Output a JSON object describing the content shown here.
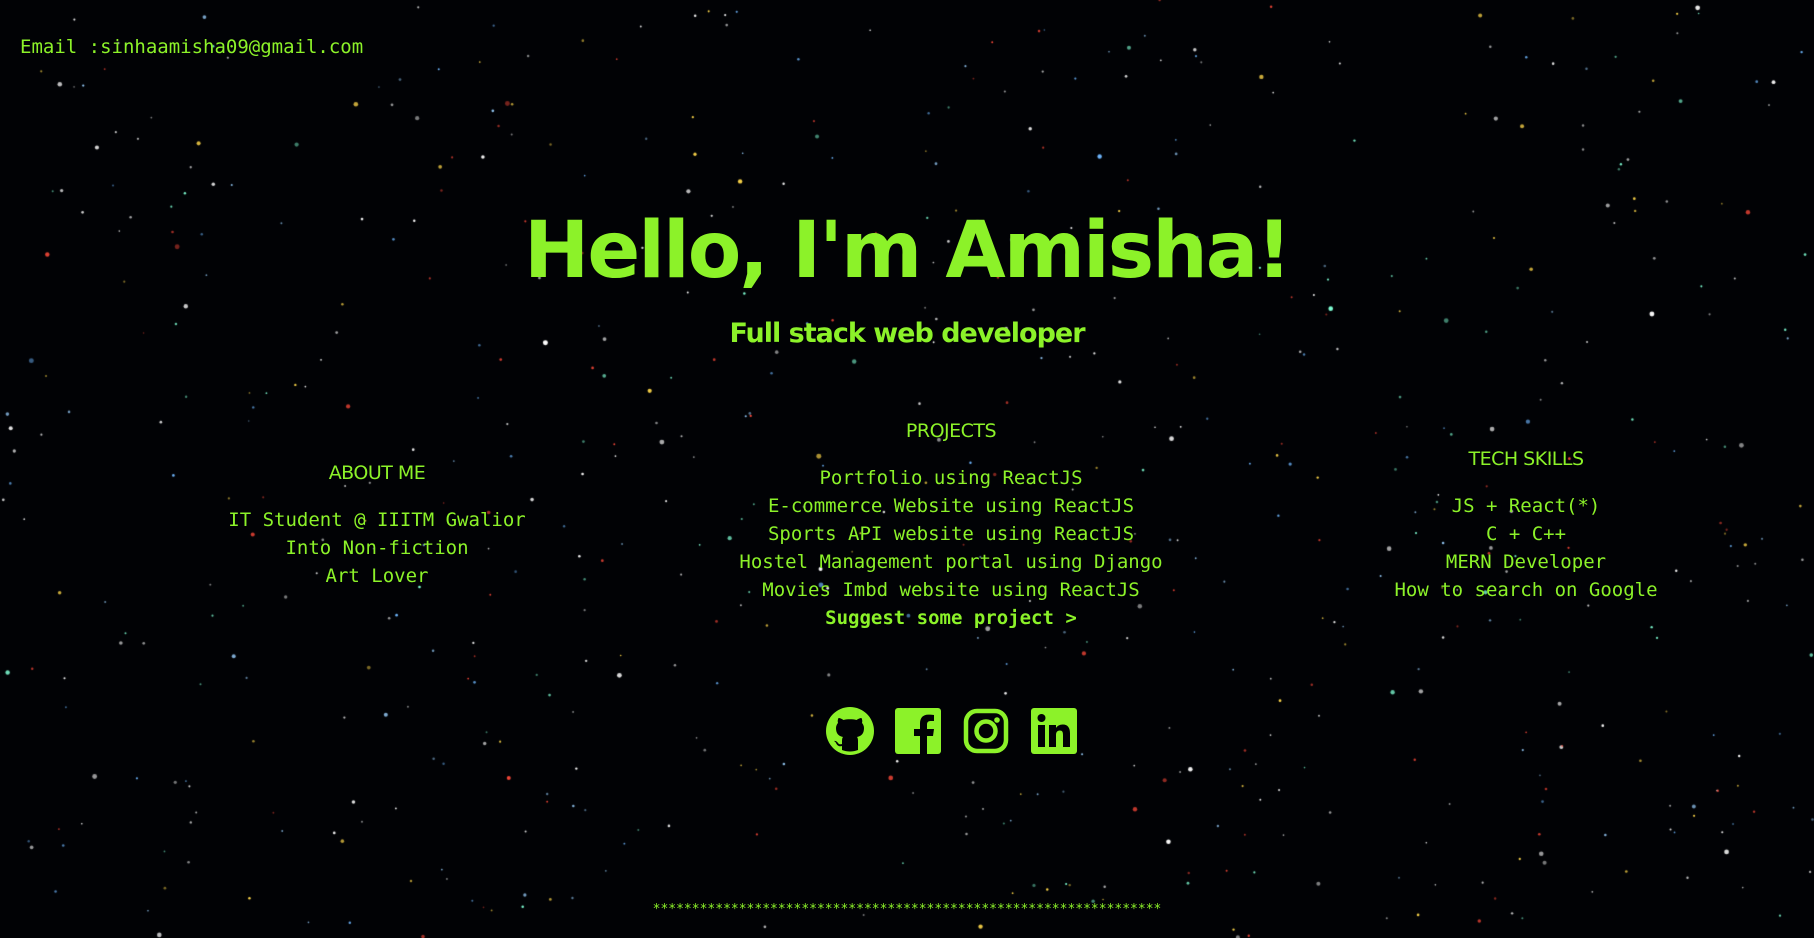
{
  "email": "Email :sinhaamisha09@gmail.com",
  "hero": {
    "title": "Hello, I'm Amisha!",
    "subtitle": "Full stack web developer"
  },
  "about": {
    "heading": "ABOUT ME",
    "items": [
      "IT Student @ IIITM Gwalior",
      "Into Non-fiction",
      "Art Lover"
    ]
  },
  "projects": {
    "heading": "PROJECTS",
    "items": [
      "Portfolio using ReactJS",
      "E-commerce Website using ReactJS",
      "Sports API website using ReactJS",
      "Hostel Management portal using Django",
      "Movies Imbd website using ReactJS"
    ],
    "suggest_label": "Suggest some project >"
  },
  "skills": {
    "heading": "TECH SKILLS",
    "items": [
      "JS + React(*)",
      "C + C++",
      "MERN Developer",
      "How to search on Google"
    ]
  },
  "socials": [
    {
      "name": "github-icon"
    },
    {
      "name": "facebook-icon"
    },
    {
      "name": "instagram-icon"
    },
    {
      "name": "linkedin-icon"
    }
  ],
  "footer": "*****************************************************************",
  "colors": {
    "accent": "#8cf229",
    "background": "#010205"
  }
}
